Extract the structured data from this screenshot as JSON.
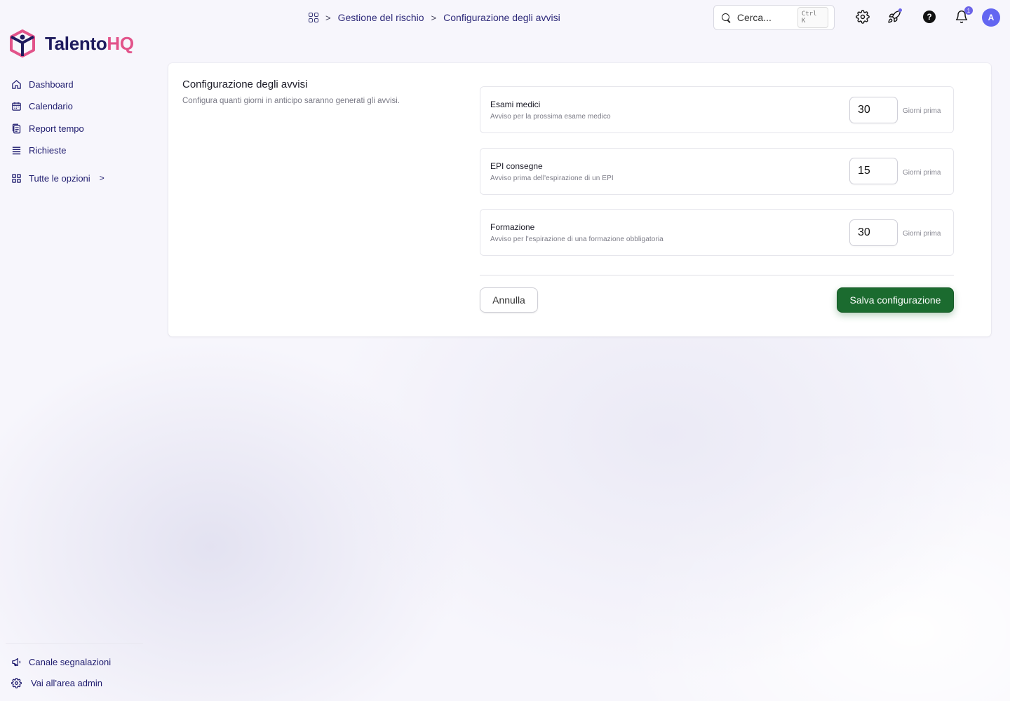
{
  "breadcrumb": {
    "items": [
      "Gestione del rischio",
      "Configurazione degli avvisi"
    ]
  },
  "topbar": {
    "search_placeholder": "Cerca...",
    "search_shortcut": "Ctrl K",
    "notification_count": "1",
    "avatar_initial": "A"
  },
  "logo": {
    "name_part1": "Talento",
    "name_part2": "HQ",
    "colors": {
      "primary": "#1e1b5e",
      "accent": "#e2538a"
    }
  },
  "sidebar": {
    "items": [
      {
        "label": "Dashboard",
        "icon": "home-icon"
      },
      {
        "label": "Calendario",
        "icon": "calendar-icon"
      },
      {
        "label": "Report tempo",
        "icon": "report-icon"
      },
      {
        "label": "Richieste",
        "icon": "list-icon"
      }
    ],
    "all_options": {
      "label": "Tutte le opzioni",
      "icon": "grid-icon"
    },
    "bottom_items": [
      {
        "label": "Canale segnalazioni",
        "icon": "megaphone-icon"
      },
      {
        "label": "Vai all'area admin",
        "icon": "gear-icon"
      }
    ]
  },
  "card": {
    "title": "Configurazione degli avvisi",
    "description": "Configura quanti giorni in anticipo saranno generati gli avvisi.",
    "settings": [
      {
        "title": "Esami medici",
        "description": "Avviso per la prossima esame medico",
        "value": "30",
        "unit": "Giorni prima"
      },
      {
        "title": "EPI consegne",
        "description": "Avviso prima dell'espirazione di un EPI",
        "value": "15",
        "unit": "Giorni prima"
      },
      {
        "title": "Formazione",
        "description": "Avviso per l'espirazione di una formazione obbligatoria",
        "value": "30",
        "unit": "Giorni prima"
      }
    ],
    "cancel_label": "Annulla",
    "save_label": "Salva configurazione",
    "save_color": "#1b6b2f"
  }
}
